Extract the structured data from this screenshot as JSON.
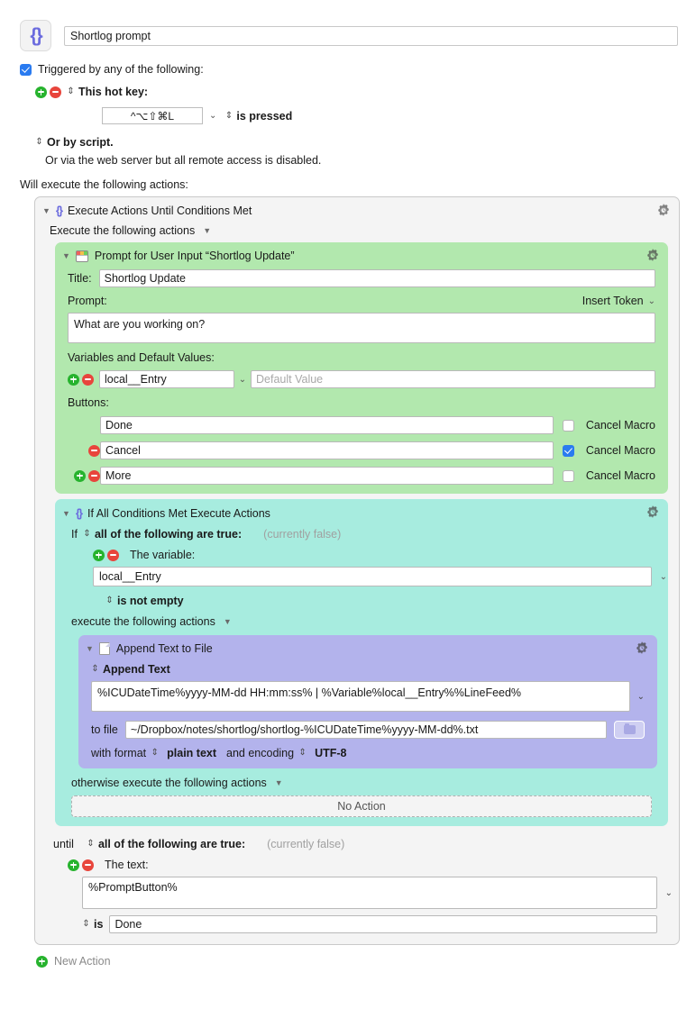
{
  "macro": {
    "icon": "braces-icon",
    "name": "Shortlog prompt"
  },
  "trigger": {
    "checkbox_label": "Triggered by any of the following:",
    "checked": true,
    "hotkey_label": "This hot key:",
    "hotkey_value": "^⌥⇧⌘L",
    "hotkey_condition": "is pressed",
    "script_label": "Or by script.",
    "webserver_note": "Or via the web server but all remote access is disabled.",
    "will_execute": "Will execute the following actions:"
  },
  "outer_action": {
    "title": "Execute Actions Until Conditions Met",
    "execute_label": "Execute the following actions",
    "gear_icon": "gear-clock-icon"
  },
  "prompt_action": {
    "title": "Prompt for User Input “Shortlog Update”",
    "icon": "window-icon",
    "gear_icon": "gear-clock-icon",
    "title_label": "Title:",
    "title_value": "Shortlog Update",
    "prompt_label": "Prompt:",
    "insert_token": "Insert Token",
    "prompt_value": "What are you working on?",
    "variables_label": "Variables and Default Values:",
    "variable_name": "local__Entry",
    "default_placeholder": "Default Value",
    "buttons_label": "Buttons:",
    "buttons": [
      {
        "label": "Done",
        "cancel_macro": false,
        "cancel_label": "Cancel Macro",
        "has_plus": false,
        "has_minus": false
      },
      {
        "label": "Cancel",
        "cancel_macro": true,
        "cancel_label": "Cancel Macro",
        "has_plus": false,
        "has_minus": true
      },
      {
        "label": "More",
        "cancel_macro": false,
        "cancel_label": "Cancel Macro",
        "has_plus": true,
        "has_minus": true
      }
    ]
  },
  "if_action": {
    "title": "If All Conditions Met Execute Actions",
    "gear_icon": "gear-clock-icon",
    "if_label": "If",
    "all_true_label": "all of the following are true:",
    "currently": "(currently false)",
    "variable_label": "The variable:",
    "variable_value": "local__Entry",
    "operator": "is not empty",
    "execute_label": "execute the following actions",
    "otherwise_label": "otherwise execute the following actions",
    "no_action": "No Action"
  },
  "append_action": {
    "title": "Append Text to File",
    "icon": "document-icon",
    "gear_icon": "gear-clock-icon",
    "append_label": "Append Text",
    "append_text": "%ICUDateTime%yyyy-MM-dd HH:mm:ss% | %Variable%local__Entry%%LineFeed%",
    "to_file_label": "to file",
    "file_path": "~/Dropbox/notes/shortlog/shortlog-%ICUDateTime%yyyy-MM-dd%.txt",
    "folder_icon": "folder-icon",
    "with_format_label": "with format",
    "format_value": "plain text",
    "and_encoding_label": "and encoding",
    "encoding_value": "UTF-8"
  },
  "until": {
    "until_label": "until",
    "all_true_label": "all of the following are true:",
    "currently": "(currently false)",
    "text_label": "The text:",
    "text_value": "%PromptButton%",
    "is_label": "is",
    "is_value": "Done"
  },
  "footer": {
    "new_action": "New Action",
    "plus_icon": "plus-circle-icon"
  },
  "colors": {
    "green_block": "#b2e8ae",
    "teal_block": "#a7ecdf",
    "purple_block": "#b3b3ec",
    "accent_blue": "#2a7bf0",
    "macro_icon": "#6b6bde",
    "plus": "#27b32e",
    "minus": "#e8453c"
  }
}
